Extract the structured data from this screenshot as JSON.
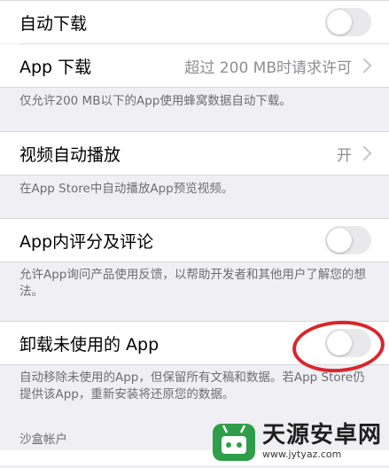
{
  "rows": {
    "auto_download": {
      "label": "自动下载",
      "toggle_on": false
    },
    "app_download": {
      "label": "App 下载",
      "value": "超过 200 MB时请求许可"
    },
    "app_download_footer": "仅允许200 MB以下的App使用蜂窝数据自动下载。",
    "video_autoplay": {
      "label": "视频自动播放",
      "value": "开"
    },
    "video_autoplay_footer": "在App Store中自动播放App预览视频。",
    "ratings": {
      "label": "App内评分及评论",
      "toggle_on": false
    },
    "ratings_footer": "允许App询问产品使用反馈，以帮助开发者和其他用户了解您的想法。",
    "offload": {
      "label": "卸载未使用的 App",
      "toggle_on": false
    },
    "offload_footer": "自动移除未使用的App，但保留所有文稿和数据。若App Store仍提供该App，重新安装将还原您的数据。",
    "sandbox_header": "沙盒帐户"
  },
  "annotation": {
    "color": "#d8262c",
    "shape": "ellipse-around-offload-toggle"
  },
  "watermark": {
    "title": "天源安卓网",
    "url": "www.jytyaz.com"
  },
  "colors": {
    "background": "#efeff4",
    "toggle_off": "#e9e9eb",
    "secondary_text": "#8e8e93",
    "footer_text": "#6d6d72"
  }
}
